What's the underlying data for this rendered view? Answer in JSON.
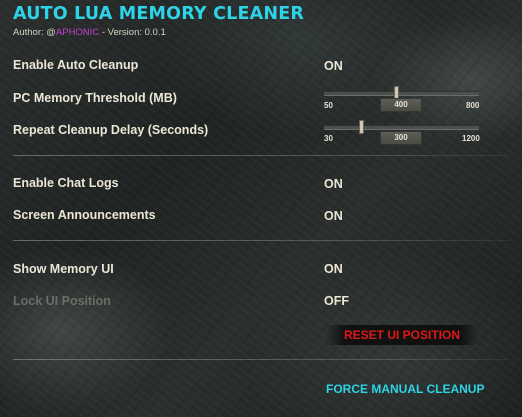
{
  "header": {
    "title": "AUTO LUA MEMORY CLEANER",
    "author_prefix": "Author: @",
    "author_name": "APHONIC",
    "version_text": " - Version: 0.0.1"
  },
  "colors": {
    "title": "#2ed3e8",
    "author": "#c040d0",
    "reset_button": "#e01818",
    "force_button": "#2ed3e8",
    "disabled_label": "#6e6c66"
  },
  "settings": {
    "enable_auto_cleanup": {
      "label": "Enable Auto Cleanup",
      "value": "ON"
    },
    "pc_memory_threshold": {
      "label": "PC Memory Threshold (MB)",
      "min": "50",
      "max": "800",
      "value": "400",
      "min_num": 50,
      "max_num": 800,
      "value_num": 400
    },
    "repeat_cleanup_delay": {
      "label": "Repeat Cleanup Delay (Seconds)",
      "min": "30",
      "max": "1200",
      "value": "300",
      "min_num": 30,
      "max_num": 1200,
      "value_num": 300
    },
    "enable_chat_logs": {
      "label": "Enable Chat Logs",
      "value": "ON"
    },
    "screen_announcements": {
      "label": "Screen Announcements",
      "value": "ON"
    },
    "show_memory_ui": {
      "label": "Show Memory UI",
      "value": "ON"
    },
    "lock_ui_position": {
      "label": "Lock UI Position",
      "value": "OFF",
      "disabled": true
    }
  },
  "buttons": {
    "reset_ui_position": "RESET UI POSITION",
    "force_manual_cleanup": "FORCE MANUAL CLEANUP"
  }
}
